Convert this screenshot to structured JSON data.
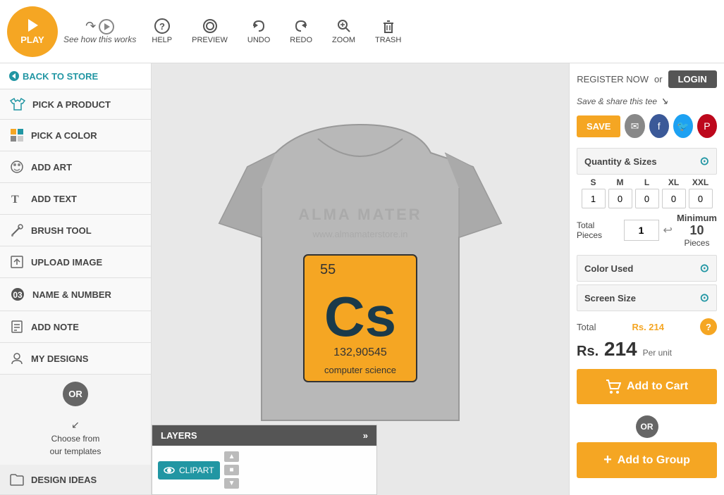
{
  "header": {
    "play_label": "PLAY",
    "help_label": "See how this works",
    "help2_label": "HELP",
    "preview_label": "PREVIEW",
    "undo_label": "UNDO",
    "redo_label": "REDO",
    "zoom_label": "ZOOM",
    "trash_label": "TRASH"
  },
  "sidebar": {
    "back_label": "BACK TO STORE",
    "items": [
      {
        "id": "pick-product",
        "label": "PICK A PRODUCT"
      },
      {
        "id": "pick-color",
        "label": "PICK A COLOR"
      },
      {
        "id": "add-art",
        "label": "ADD ART"
      },
      {
        "id": "add-text",
        "label": "ADD TEXT"
      },
      {
        "id": "brush-tool",
        "label": "BRUSH TOOL"
      },
      {
        "id": "upload-image",
        "label": "UPLOAD IMAGE"
      },
      {
        "id": "name-number",
        "label": "NAME & NUMBER"
      },
      {
        "id": "add-note",
        "label": "ADD NOTE"
      },
      {
        "id": "my-designs",
        "label": "MY DESIGNS"
      }
    ],
    "or_label": "OR",
    "choose_templates_line1": "Choose from",
    "choose_templates_line2": "our templates",
    "design_ideas_label": "DESIGN IDEAS"
  },
  "layers": {
    "title": "LAYERS",
    "expand_icon": "»",
    "clipart_label": "CLIPART"
  },
  "right": {
    "register_label": "REGISTER NOW",
    "or_label": "or",
    "login_label": "LOGIN",
    "save_share_label": "Save & share this tee",
    "save_label": "SAVE",
    "qty_sizes_title": "Quantity & Sizes",
    "sizes": [
      "S",
      "M",
      "L",
      "XL",
      "XXL"
    ],
    "size_values": [
      "1",
      "0",
      "0",
      "0",
      "0"
    ],
    "total_pieces_label": "Total Pieces",
    "total_pieces_value": "1",
    "min_pieces_label": "Minimum",
    "min_pieces_value": "10",
    "min_pieces_suffix": "Pieces",
    "color_used_title": "Color Used",
    "screen_size_title": "Screen Size",
    "total_label": "Total",
    "total_amount": "Rs. 214",
    "price_currency": "Rs.",
    "price_value": "214",
    "per_unit_label": "Per unit",
    "add_to_cart_label": "Add to Cart",
    "or2_label": "OR",
    "add_to_group_label": "Add to Group"
  },
  "tshirt": {
    "brand_line1": "ALMA MATER",
    "brand_line2": "www.almamaterstore.in",
    "element_number": "55",
    "element_symbol": "Cs",
    "element_mass": "132,90545",
    "element_name": "computer science"
  }
}
